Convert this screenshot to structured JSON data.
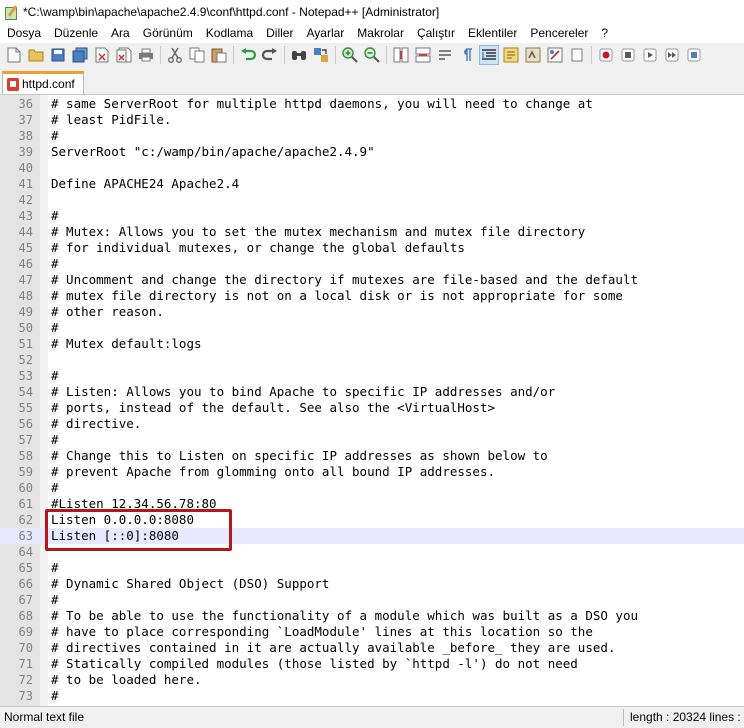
{
  "window": {
    "title": "*C:\\wamp\\bin\\apache\\apache2.4.9\\conf\\httpd.conf - Notepad++ [Administrator]"
  },
  "menu": [
    "Dosya",
    "Düzenle",
    "Ara",
    "Görünüm",
    "Kodlama",
    "Diller",
    "Ayarlar",
    "Makrolar",
    "Çalıştır",
    "Eklentiler",
    "Pencereler",
    "?"
  ],
  "toolbar": {
    "icons": [
      "new-file-icon",
      "open-file-icon",
      "save-icon",
      "save-all-icon",
      "close-icon",
      "close-all-icon",
      "print-icon",
      "cut-icon",
      "copy-icon",
      "paste-icon",
      "undo-icon",
      "redo-icon",
      "find-icon",
      "replace-icon",
      "zoom-in-icon",
      "zoom-out-icon",
      "sync-vertical-icon",
      "sync-horizontal-icon",
      "word-wrap-icon",
      "show-all-chars-icon",
      "indent-guide-icon",
      "doc-map-icon",
      "function-list-icon",
      "folder-workspace-icon",
      "monitoring-icon",
      "record-macro-icon",
      "stop-macro-icon",
      "play-macro-icon",
      "run-macro-multiple-icon",
      "save-macro-icon"
    ],
    "colors": {
      "new": "#f5f5f5",
      "open": "#e8c45a",
      "save": "#4a7fc4",
      "print": "#7a7a7a",
      "cut": "#8a8a8a",
      "undo": "#2e9e3e",
      "find": "#5a5a5a",
      "zoom": "#3b8c3b",
      "record": "#c0192e",
      "stop": "#5a5a5a",
      "play": "#5a5a5a"
    }
  },
  "tab": {
    "label": "httpd.conf",
    "accent": "#f89d2d"
  },
  "editor": {
    "lines": [
      {
        "n": "36",
        "t": "# same ServerRoot for multiple httpd daemons, you will need to change at"
      },
      {
        "n": "37",
        "t": "# least PidFile."
      },
      {
        "n": "38",
        "t": "#"
      },
      {
        "n": "39",
        "t": "ServerRoot \"c:/wamp/bin/apache/apache2.4.9\""
      },
      {
        "n": "40",
        "t": ""
      },
      {
        "n": "41",
        "t": "Define APACHE24 Apache2.4"
      },
      {
        "n": "42",
        "t": ""
      },
      {
        "n": "43",
        "t": "#"
      },
      {
        "n": "44",
        "t": "# Mutex: Allows you to set the mutex mechanism and mutex file directory"
      },
      {
        "n": "45",
        "t": "# for individual mutexes, or change the global defaults"
      },
      {
        "n": "46",
        "t": "#"
      },
      {
        "n": "47",
        "t": "# Uncomment and change the directory if mutexes are file-based and the default"
      },
      {
        "n": "48",
        "t": "# mutex file directory is not on a local disk or is not appropriate for some"
      },
      {
        "n": "49",
        "t": "# other reason."
      },
      {
        "n": "50",
        "t": "#"
      },
      {
        "n": "51",
        "t": "# Mutex default:logs"
      },
      {
        "n": "52",
        "t": ""
      },
      {
        "n": "53",
        "t": "#"
      },
      {
        "n": "54",
        "t": "# Listen: Allows you to bind Apache to specific IP addresses and/or"
      },
      {
        "n": "55",
        "t": "# ports, instead of the default. See also the <VirtualHost>"
      },
      {
        "n": "56",
        "t": "# directive."
      },
      {
        "n": "57",
        "t": "#"
      },
      {
        "n": "58",
        "t": "# Change this to Listen on specific IP addresses as shown below to"
      },
      {
        "n": "59",
        "t": "# prevent Apache from glomming onto all bound IP addresses."
      },
      {
        "n": "60",
        "t": "#"
      },
      {
        "n": "61",
        "t": "#Listen 12.34.56.78:80"
      },
      {
        "n": "62",
        "t": "Listen 0.0.0.0:8080"
      },
      {
        "n": "63",
        "t": "Listen [::0]:8080"
      },
      {
        "n": "64",
        "t": ""
      },
      {
        "n": "65",
        "t": "#"
      },
      {
        "n": "66",
        "t": "# Dynamic Shared Object (DSO) Support"
      },
      {
        "n": "67",
        "t": "#"
      },
      {
        "n": "68",
        "t": "# To be able to use the functionality of a module which was built as a DSO you"
      },
      {
        "n": "69",
        "t": "# have to place corresponding `LoadModule' lines at this location so the"
      },
      {
        "n": "70",
        "t": "# directives contained in it are actually available _before_ they are used."
      },
      {
        "n": "71",
        "t": "# Statically compiled modules (those listed by `httpd -l') do not need"
      },
      {
        "n": "72",
        "t": "# to be loaded here."
      },
      {
        "n": "73",
        "t": "#"
      }
    ],
    "current_line": "63",
    "highlight_color": "#b4171b"
  },
  "status": {
    "type": "Normal text file",
    "length": "length : 20324    lines :"
  }
}
